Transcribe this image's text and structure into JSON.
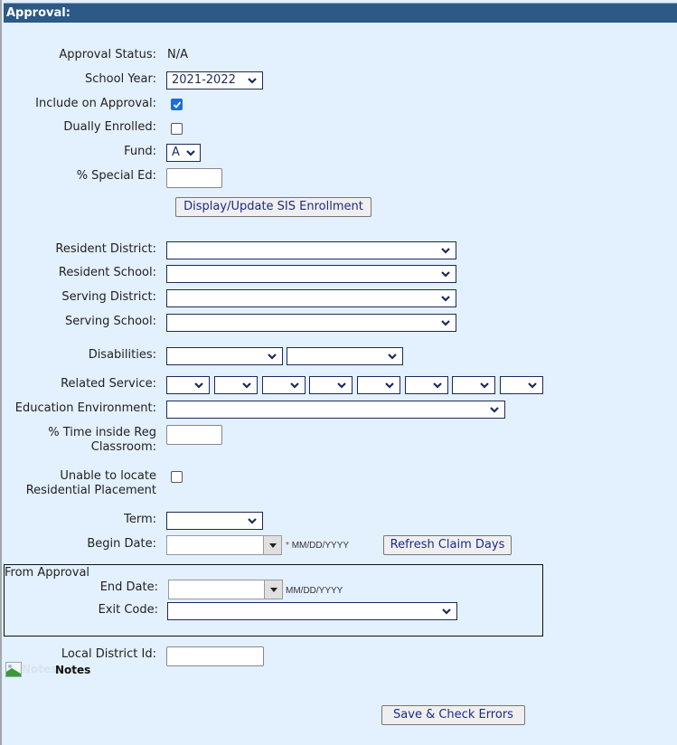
{
  "header": {
    "title": "Approval:"
  },
  "form": {
    "approval_status": {
      "label": "Approval Status:",
      "value": "N/A"
    },
    "school_year": {
      "label": "School Year:",
      "value": "2021-2022"
    },
    "include_on_approval": {
      "label": "Include on Approval:",
      "checked": true
    },
    "dually_enrolled": {
      "label": "Dually Enrolled:",
      "checked": false
    },
    "fund": {
      "label": "Fund:",
      "value": "A"
    },
    "special_ed": {
      "label": "% Special Ed:",
      "value": ""
    },
    "display_sis_button": "Display/Update SIS Enrollment",
    "resident_district": {
      "label": "Resident District:",
      "value": ""
    },
    "resident_school": {
      "label": "Resident School:",
      "value": ""
    },
    "serving_district": {
      "label": "Serving District:",
      "value": ""
    },
    "serving_school": {
      "label": "Serving School:",
      "value": ""
    },
    "disabilities": {
      "label": "Disabilities:",
      "values": [
        "",
        ""
      ]
    },
    "related_service": {
      "label": "Related Service:",
      "values": [
        "",
        "",
        "",
        "",
        "",
        "",
        "",
        ""
      ]
    },
    "education_environment": {
      "label": "Education Environment:",
      "value": ""
    },
    "time_inside_reg": {
      "label_line1": "% Time inside Reg",
      "label_line2": "Classroom:",
      "value": ""
    },
    "unable_to_locate": {
      "label_line1": "Unable to locate",
      "label_line2": "Residential Placement",
      "checked": false
    },
    "term": {
      "label": "Term:",
      "value": ""
    },
    "begin_date": {
      "label": "Begin Date:",
      "value": "",
      "required_mark": "*",
      "format_hint": "MM/DD/YYYY"
    },
    "refresh_claim_days_button": "Refresh Claim Days",
    "from_approval": {
      "legend": "From Approval",
      "end_date": {
        "label": "End Date:",
        "value": "",
        "format_hint": "MM/DD/YYYY"
      },
      "exit_code": {
        "label": "Exit Code:",
        "value": ""
      }
    },
    "local_district_id": {
      "label": "Local District Id:",
      "value": ""
    },
    "notes": {
      "image_alt": "Notes",
      "label": "Notes"
    },
    "save_button": "Save & Check Errors"
  },
  "colors": {
    "header_bg": "#2d5986",
    "page_bg": "#e3f0fd",
    "select_text": "#1d2a5a",
    "required": "#d0202a"
  }
}
